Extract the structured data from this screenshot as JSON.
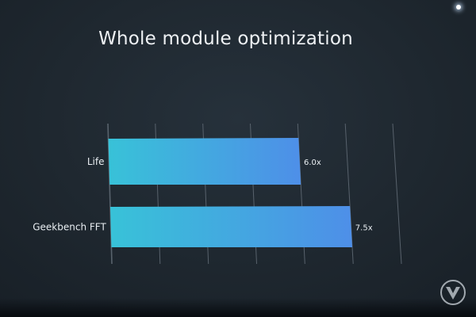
{
  "slide": {
    "title": "Whole module optimization"
  },
  "chart_data": {
    "type": "bar",
    "orientation": "horizontal",
    "title": "Whole module optimization",
    "categories": [
      "Life",
      "Geekbench FFT"
    ],
    "values": [
      6.0,
      7.5
    ],
    "value_labels": [
      "6.0x",
      "7.5x"
    ],
    "xlabel": "",
    "ylabel": "",
    "xlim": [
      0,
      9
    ],
    "grid": true,
    "legend": "none"
  },
  "colors": {
    "background": "#1b2129",
    "bar_start": "#38c2d8",
    "bar_end": "#4e8fe8",
    "grid": "#58626c",
    "text": "#e9eef2"
  },
  "icons": {
    "watermark": "verge-logo-icon",
    "light": "stage-light-icon"
  }
}
